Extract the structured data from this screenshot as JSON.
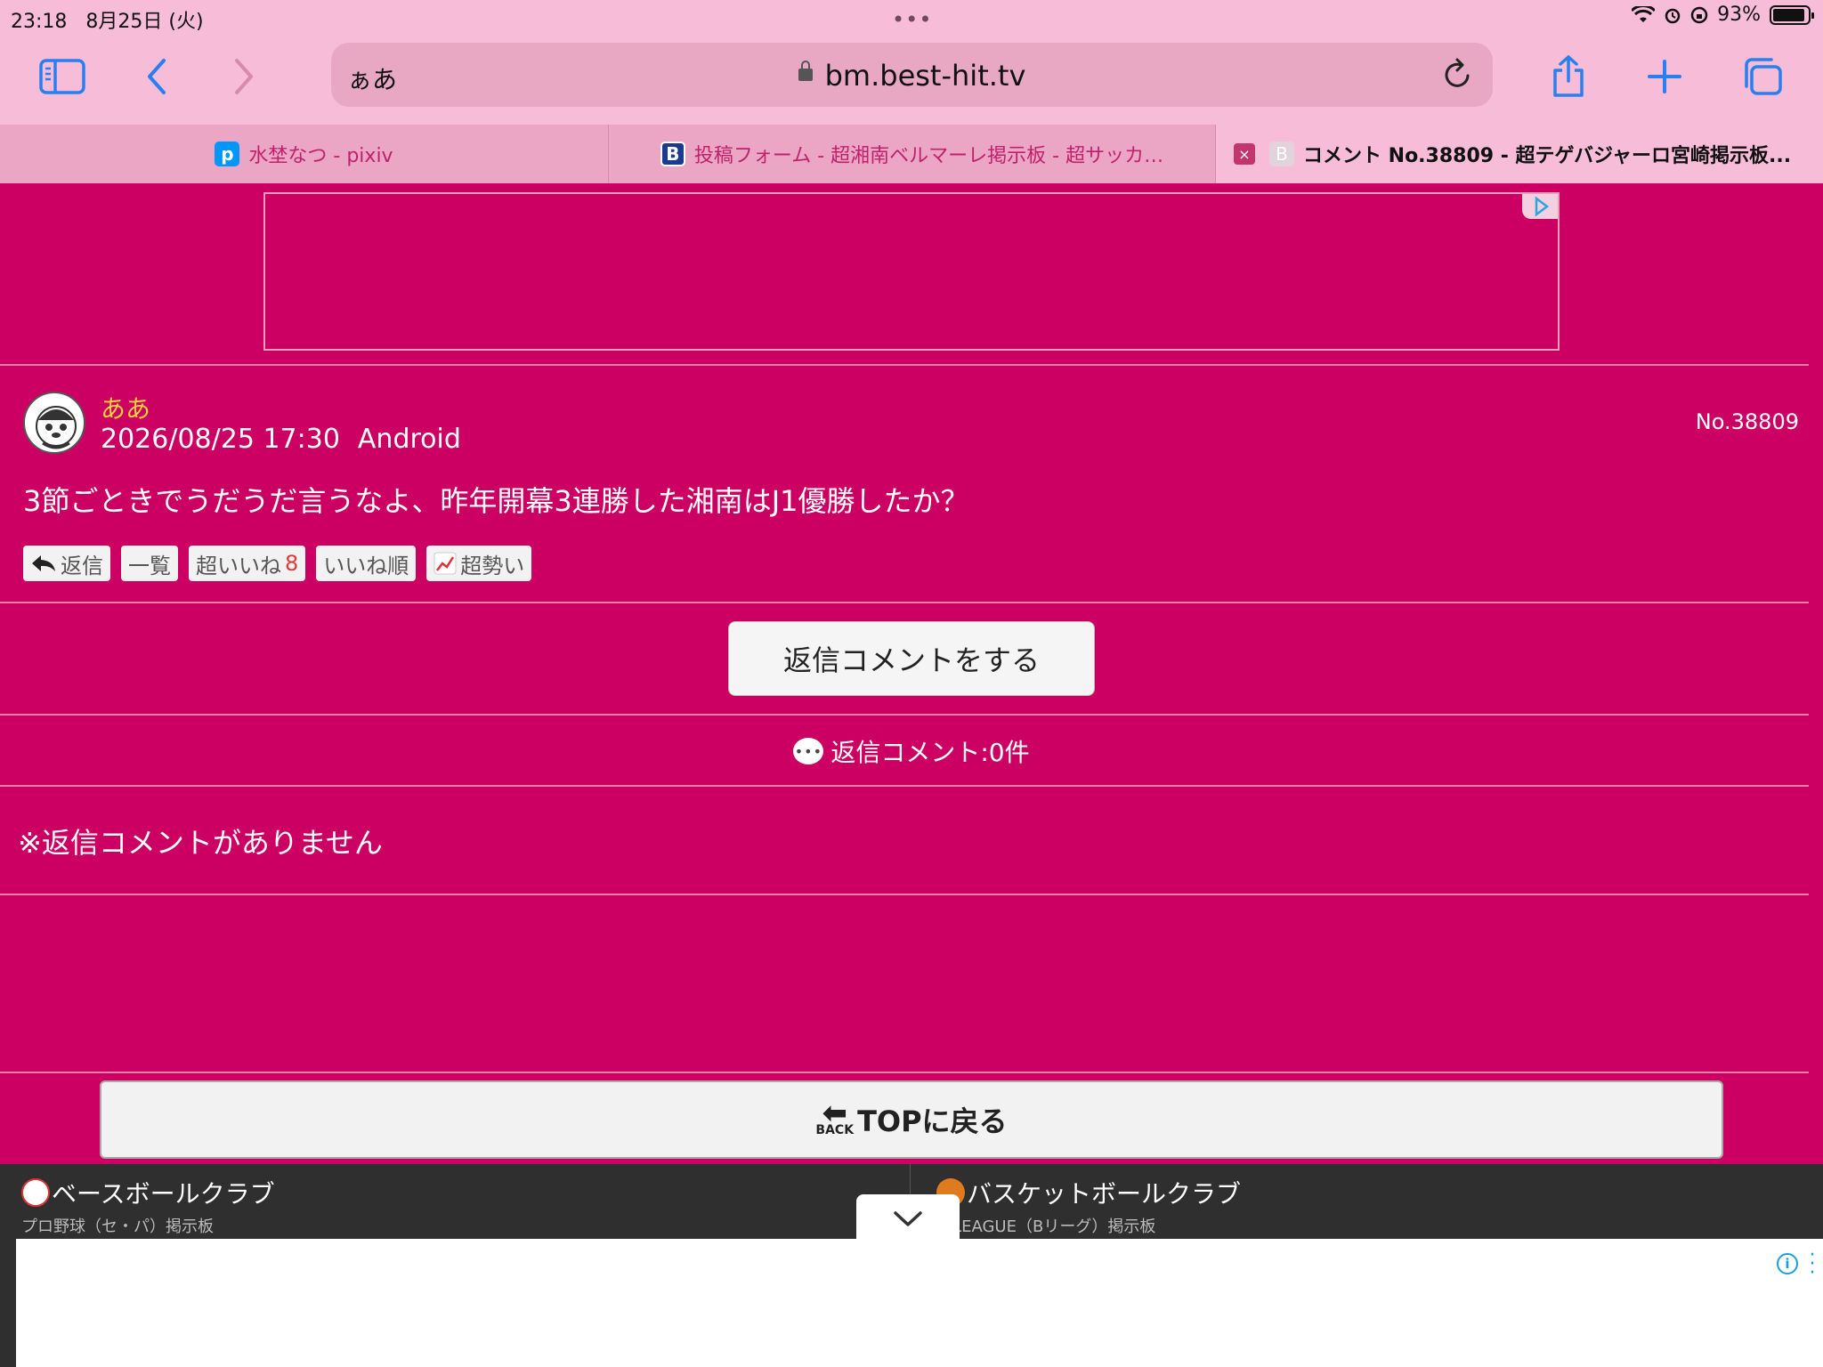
{
  "status": {
    "time": "23:18",
    "date": "8月25日 (火)",
    "battery": "93%",
    "battery_level": 0.93
  },
  "browser": {
    "addr_text_size": "ぁあ",
    "url": "bm.best-hit.tv",
    "tabs": [
      {
        "label": "水埜なつ - pixiv",
        "favicon": "p",
        "favicon_color": "#0096fa"
      },
      {
        "label": "投稿フォーム - 超湘南ベルマーレ掲示板 - 超サッカ…",
        "favicon": "B",
        "favicon_color": "#1a3b8f"
      },
      {
        "label": "コメント No.38809 - 超テゲバジャーロ宮崎掲示板...",
        "favicon": "B",
        "favicon_color": "#d8c9d0",
        "close": "×"
      }
    ]
  },
  "post": {
    "user": "ああ",
    "datetime": "2026/08/25 17:30",
    "device": "Android",
    "number": "No.38809",
    "body": "3節ごときでうだうだ言うなよ、昨年開幕3連勝した湘南はJ1優勝したか？",
    "actions": {
      "reply": "返信",
      "list": "一覧",
      "super_like": "超いいね",
      "super_like_count": "8",
      "like_order": "いいね順",
      "momentum": "超勢い"
    }
  },
  "reply_button": "返信コメントをする",
  "reply_count": "返信コメント:0件",
  "no_reply": "※返信コメントがありません",
  "top_button": {
    "icon_label": "BACK",
    "label": "TOPに戻る"
  },
  "footer": {
    "left": {
      "title": "ベースボールクラブ",
      "sub": "プロ野球（セ・パ）掲示板"
    },
    "right": {
      "title": "バスケットボールクラブ",
      "sub": "B.LEAGUE（Bリーグ）掲示板"
    }
  },
  "colors": {
    "page_bg": "#cc0063",
    "chrome_bg": "#f6bcd8",
    "username": "#ffd23a",
    "like_count": "#e03a3a",
    "footer_bg": "#2f2f2f"
  }
}
